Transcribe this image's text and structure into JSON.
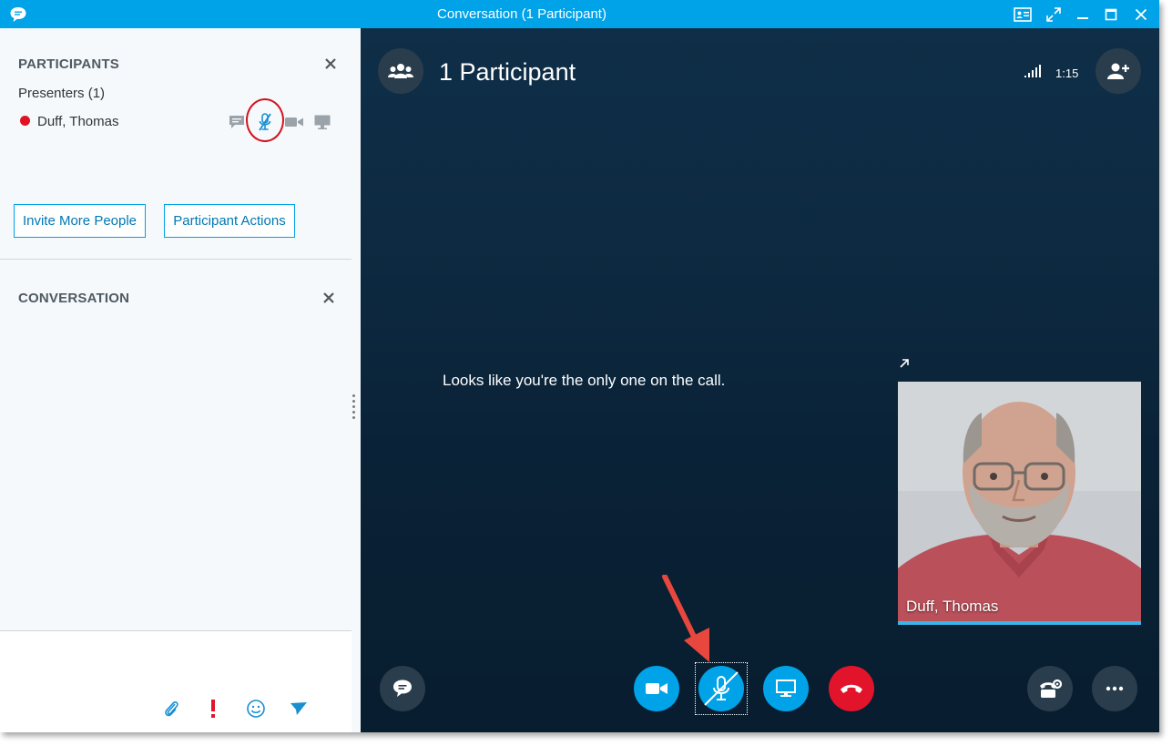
{
  "window": {
    "title": "Conversation (1 Participant)",
    "accent_color": "#00a2e8",
    "icons": [
      "chat-bubble-icon",
      "contact-card-icon",
      "fullscreen-icon",
      "minimize-icon",
      "maximize-icon",
      "close-icon"
    ]
  },
  "participants_panel": {
    "title": "PARTICIPANTS",
    "group_label": "Presenters (1)",
    "participant": {
      "name": "Duff, Thomas",
      "status_color": "#e01324"
    },
    "invite_button": "Invite More People",
    "actions_button": "Participant Actions"
  },
  "conversation_panel": {
    "title": "CONVERSATION"
  },
  "stage": {
    "title": "1 Participant",
    "timer": "1:15",
    "message": "Looks like you're the only one on the call.",
    "video_name": "Duff, Thomas"
  },
  "colors": {
    "hangup_red": "#e2142b",
    "control_blue": "#00a2e8",
    "annotation_red": "#d4111e"
  }
}
